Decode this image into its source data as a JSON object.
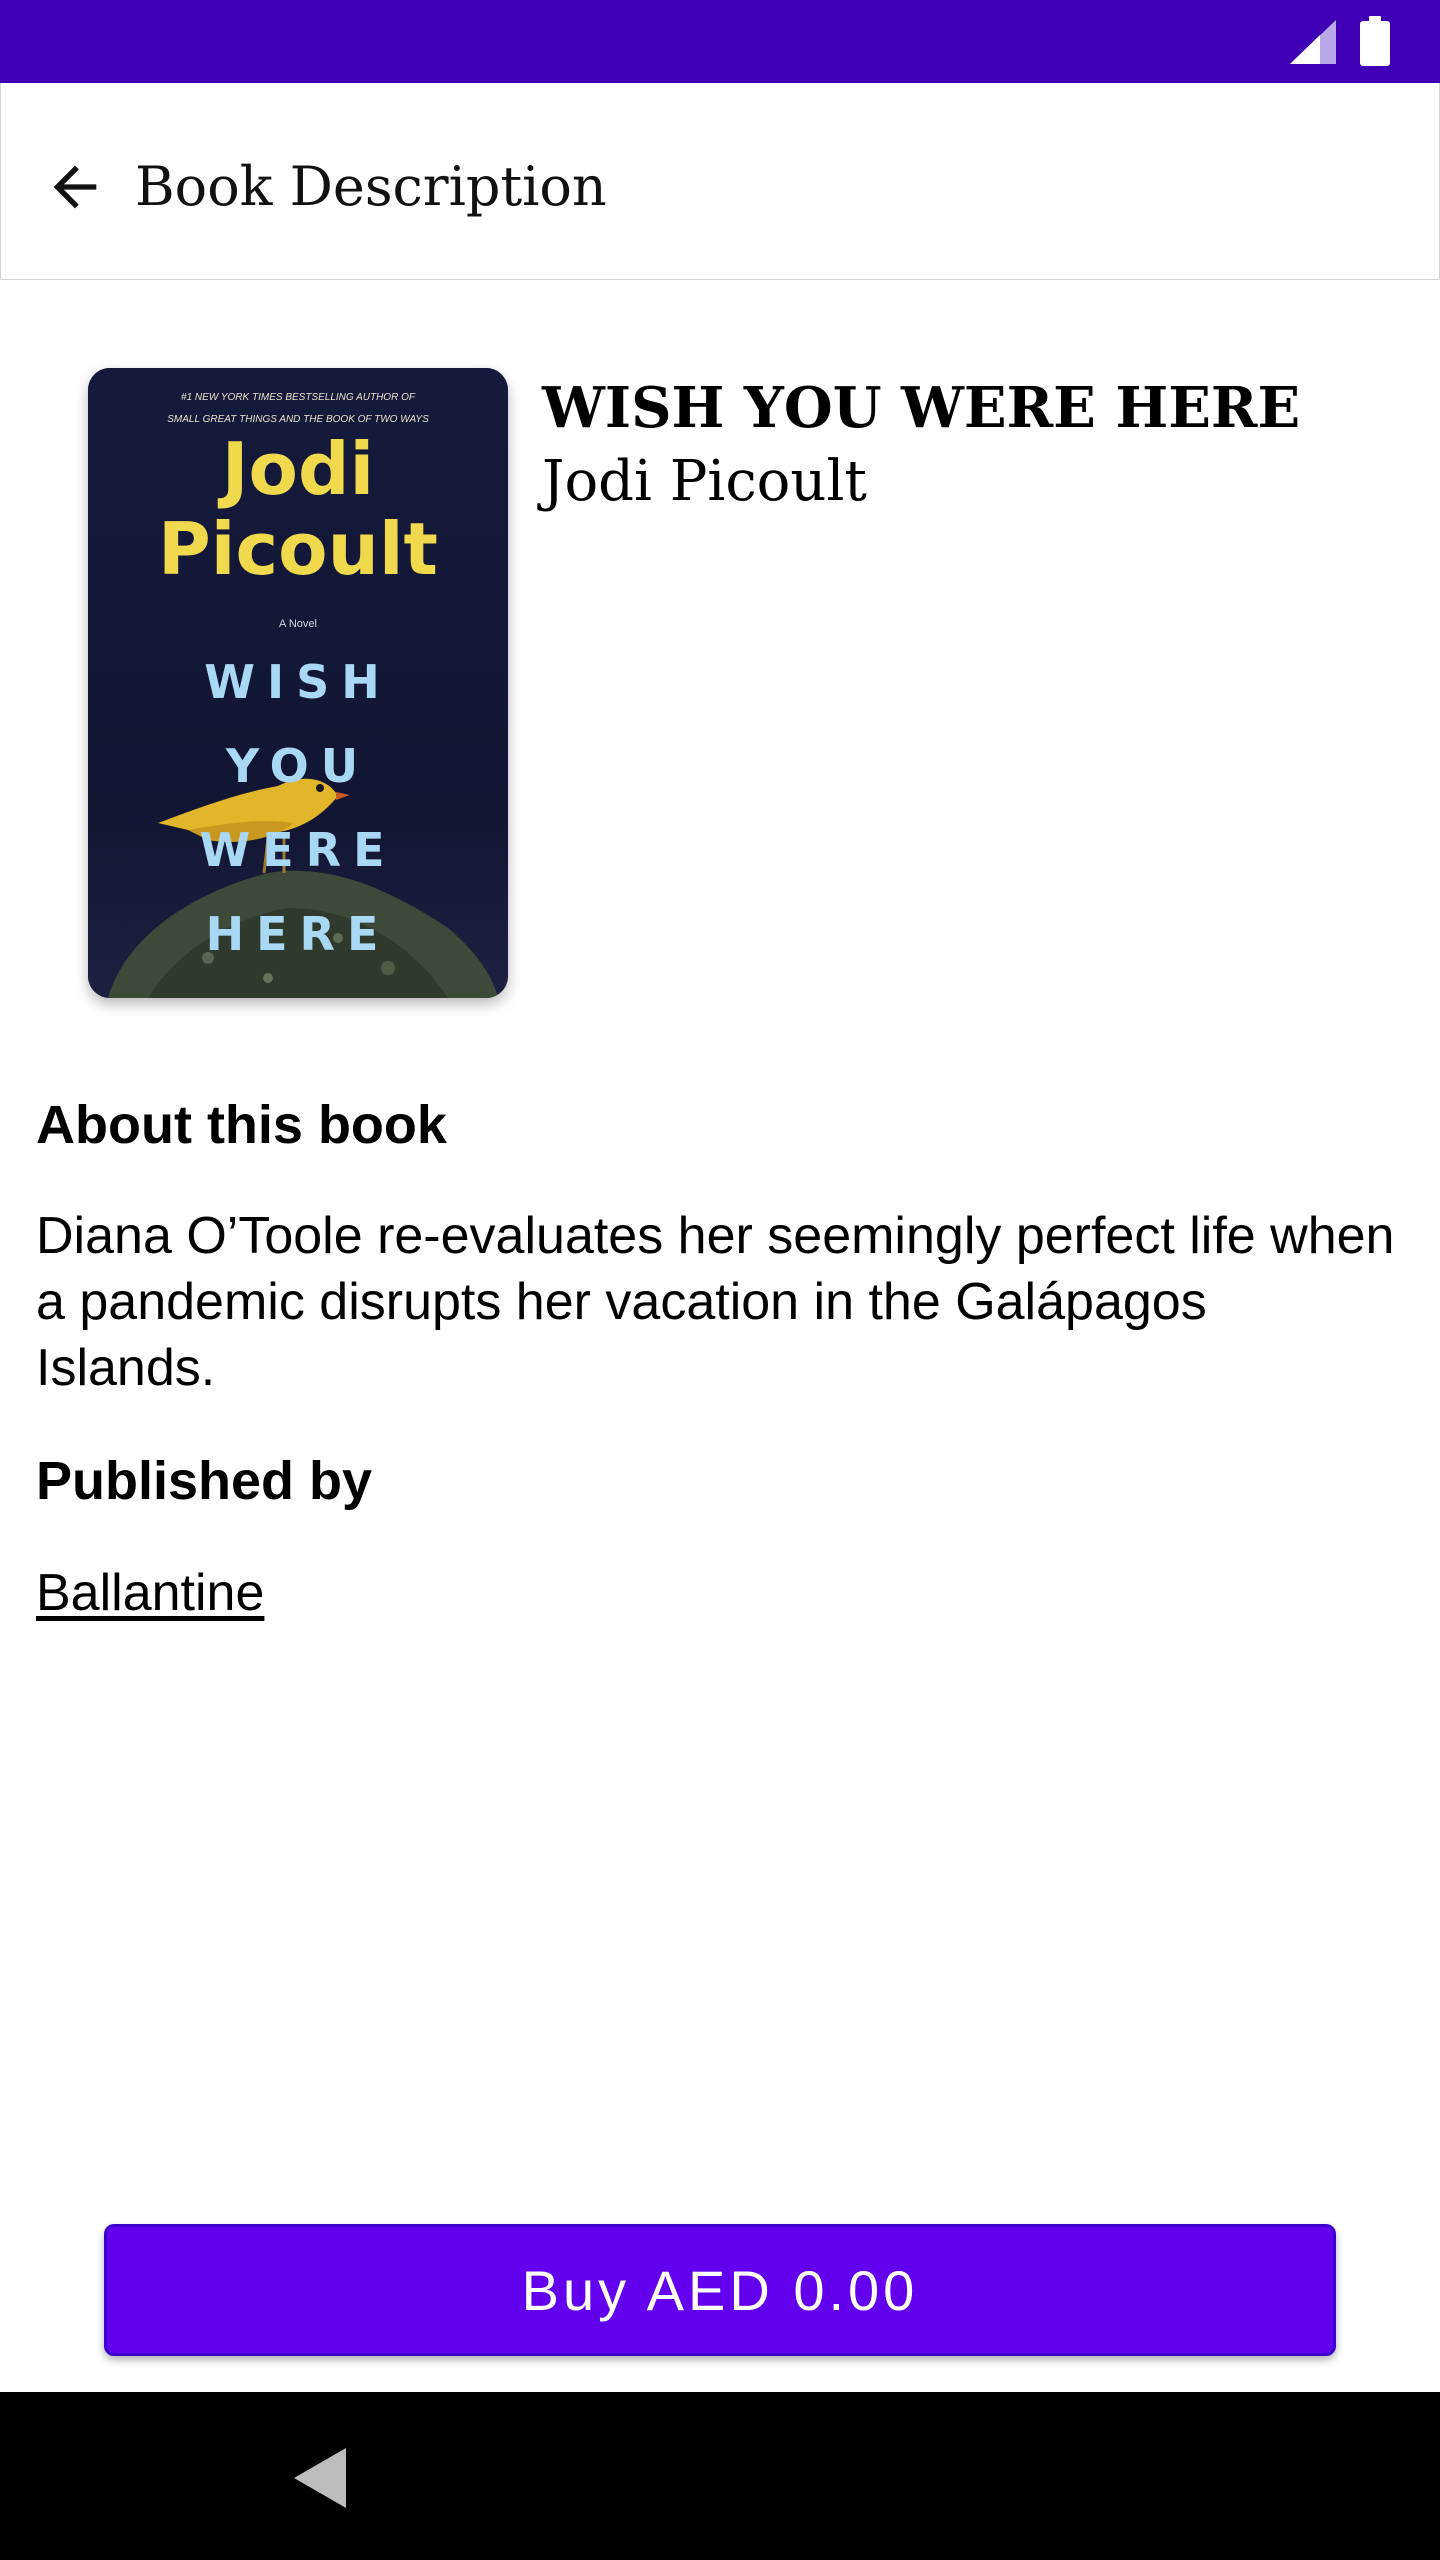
{
  "app_bar": {
    "title": "Book Description",
    "back_icon": "arrow-back-icon"
  },
  "status_bar": {
    "icons": [
      "signal-icon",
      "battery-icon"
    ],
    "background": "#3f00b5"
  },
  "book": {
    "title": "WISH YOU WERE HERE",
    "author": "Jodi Picoult",
    "cover": {
      "tagline_line1": "#1 NEW YORK TIMES BESTSELLING AUTHOR OF",
      "tagline_line2": "SMALL GREAT THINGS AND THE BOOK OF TWO WAYS",
      "author_first": "Jodi",
      "author_last": "Picoult",
      "label": "A Novel",
      "title_words": [
        "WISH",
        "YOU",
        "WERE",
        "HERE"
      ]
    }
  },
  "about": {
    "heading": "About this book",
    "description": "Diana O’Toole re-evaluates her seemingly perfect life when a pandemic disrupts her vacation in the Galápagos Islands."
  },
  "publisher": {
    "heading": "Published by",
    "name": "Ballantine"
  },
  "buy_button": {
    "label": "Buy AED 0.00",
    "color": "#6200ee"
  },
  "nav_bar": {
    "back_icon": "nav-back-triangle-icon"
  }
}
